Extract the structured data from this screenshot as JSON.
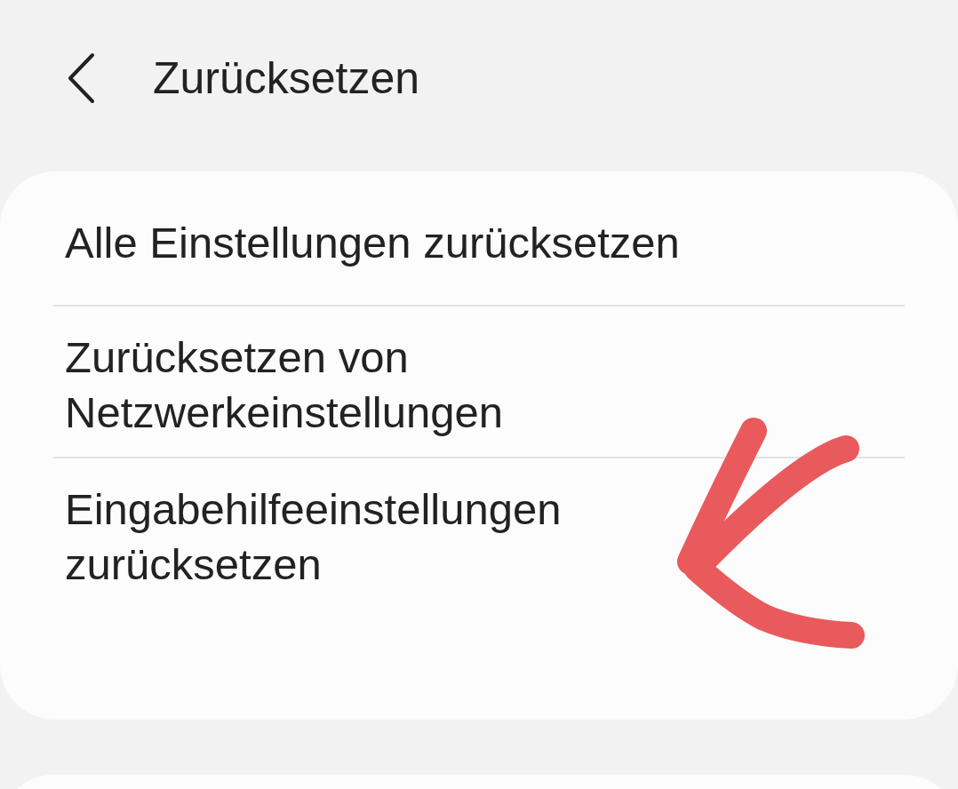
{
  "header": {
    "title": "Zurücksetzen"
  },
  "items": [
    {
      "label": "Alle Einstellungen zurücksetzen"
    },
    {
      "label": "Zurücksetzen von Netzwerkeinstellungen"
    },
    {
      "label": "Eingabehilfeeinstellungen zurücksetzen"
    }
  ]
}
